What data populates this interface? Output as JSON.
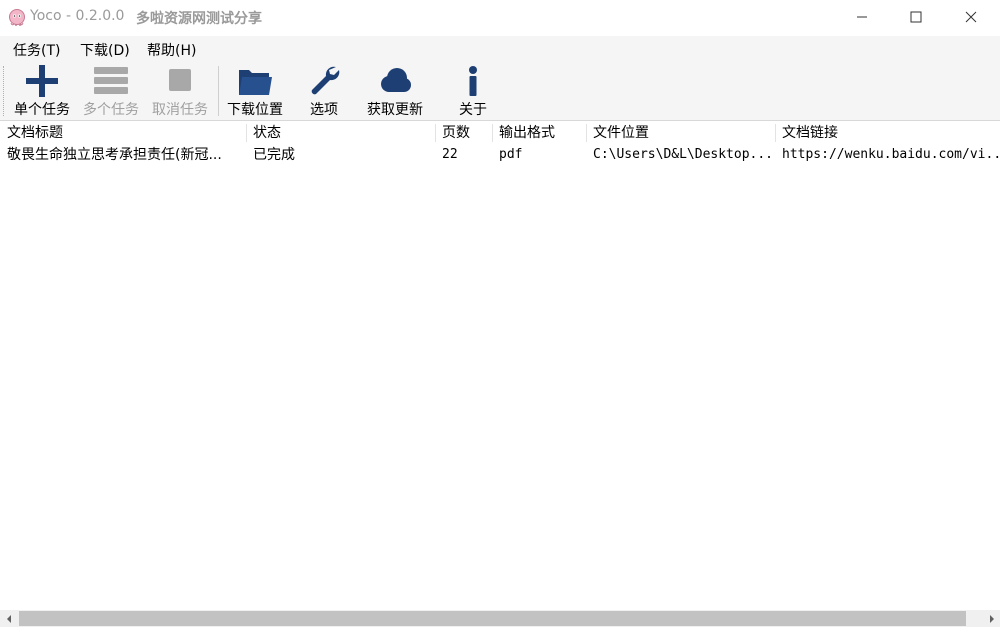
{
  "window": {
    "title": "Yoco - 0.2.0.0",
    "subtitle": "多啦资源网测试分享"
  },
  "menu": {
    "items": [
      "任务(T)",
      "下载(D)",
      "帮助(H)"
    ]
  },
  "toolbar": {
    "single_task": "单个任务",
    "multi_task": "多个任务",
    "cancel_task": "取消任务",
    "download_location": "下载位置",
    "options": "选项",
    "get_update": "获取更新",
    "about": "关于"
  },
  "colors": {
    "icon_blue": "#1e3f73",
    "icon_disabled": "#a8a8a8"
  },
  "table": {
    "columns": [
      "文档标题",
      "状态",
      "页数",
      "输出格式",
      "文件位置",
      "文档链接"
    ],
    "rows": [
      [
        "敬畏生命独立思考承担责任(新冠...",
        "已完成",
        "22",
        "pdf",
        "C:\\Users\\D&L\\Desktop...",
        "https://wenku.baidu.com/vi..."
      ]
    ]
  }
}
